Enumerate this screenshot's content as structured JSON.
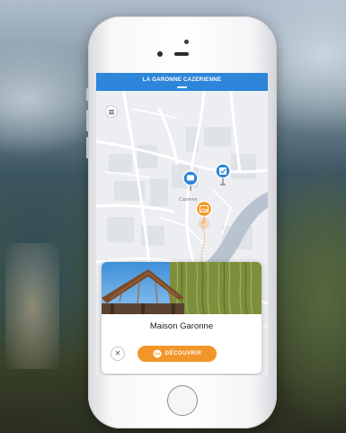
{
  "app": {
    "title": "LA GARONNE CAZERIENNE"
  },
  "map": {
    "place_label": "Cazères"
  },
  "card": {
    "title": "Maison Garonne",
    "close_label": "✕",
    "discover_label": "DÉCOUVRIR"
  },
  "colors": {
    "header_blue": "#2d86d9",
    "marker_blue": "#2d86d9",
    "marker_orange": "#f2962b",
    "river": "#b9c3cf",
    "button_orange": "#f2962b"
  },
  "icons": {
    "menu": "menu-icon",
    "close": "close-icon",
    "discover": "eye-icon",
    "markers": [
      "chat-marker-icon",
      "check-marker-icon",
      "image-marker-icon"
    ]
  }
}
